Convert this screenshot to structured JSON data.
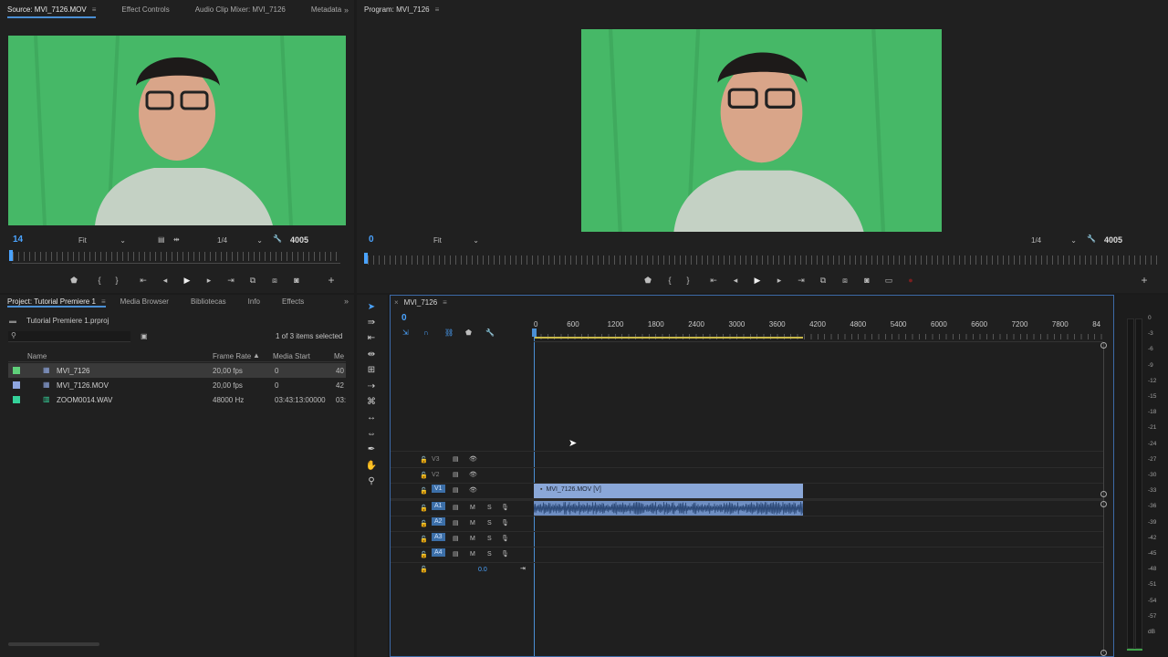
{
  "source_monitor": {
    "tabs": [
      "Source: MVI_7126.MOV",
      "Effect Controls",
      "Audio Clip Mixer: MVI_7126",
      "Metadata"
    ],
    "timecode": "14",
    "zoom": "Fit",
    "resolution": "1/4",
    "duration": "4005"
  },
  "program_monitor": {
    "tab": "Program: MVI_7126",
    "timecode": "0",
    "zoom": "Fit",
    "resolution": "1/4",
    "duration": "4005"
  },
  "project": {
    "tabs": [
      "Project: Tutorial Premiere 1",
      "Media Browser",
      "Bibliotecas",
      "Info",
      "Effects"
    ],
    "file": "Tutorial Premiere 1.prproj",
    "selection": "1 of 3 items selected",
    "columns": [
      "Name",
      "Frame Rate",
      "Media Start",
      "Me"
    ],
    "items": [
      {
        "name": "MVI_7126",
        "rate": "20,00 fps",
        "start": "0",
        "extra": "40",
        "color": "#5fd07a"
      },
      {
        "name": "MVI_7126.MOV",
        "rate": "20,00 fps",
        "start": "0",
        "extra": "42",
        "color": "#8ea6df"
      },
      {
        "name": "ZOOM0014.WAV",
        "rate": "48000 Hz",
        "start": "03:43:13:00000",
        "extra": "03:",
        "color": "#35d29a"
      }
    ]
  },
  "timeline": {
    "tab": "MVI_7126",
    "timecode": "0",
    "ruler": [
      "0",
      "600",
      "1200",
      "1800",
      "2400",
      "3000",
      "3600",
      "4200",
      "4800",
      "5400",
      "6000",
      "6600",
      "7200",
      "7800",
      "84"
    ],
    "video_tracks": [
      "V3",
      "V2",
      "V1"
    ],
    "audio_tracks": [
      "A1",
      "A2",
      "A3",
      "A4"
    ],
    "mute_label": "M",
    "solo_label": "S",
    "clip_label": "MVI_7126.MOV [V]",
    "master_value": "0.0"
  },
  "meter": {
    "labels": [
      "0",
      "-3",
      "-6",
      "-9",
      "-12",
      "-15",
      "-18",
      "-21",
      "-24",
      "-27",
      "-30",
      "-33",
      "-36",
      "-39",
      "-42",
      "-45",
      "-48",
      "-51",
      "-54",
      "-57",
      "dB"
    ]
  },
  "colors": {
    "accent": "#4a8fd4",
    "video_clip": "#8aa7d8",
    "audio_clip": "#6f8fc3",
    "greenscreen": "#46b867"
  }
}
